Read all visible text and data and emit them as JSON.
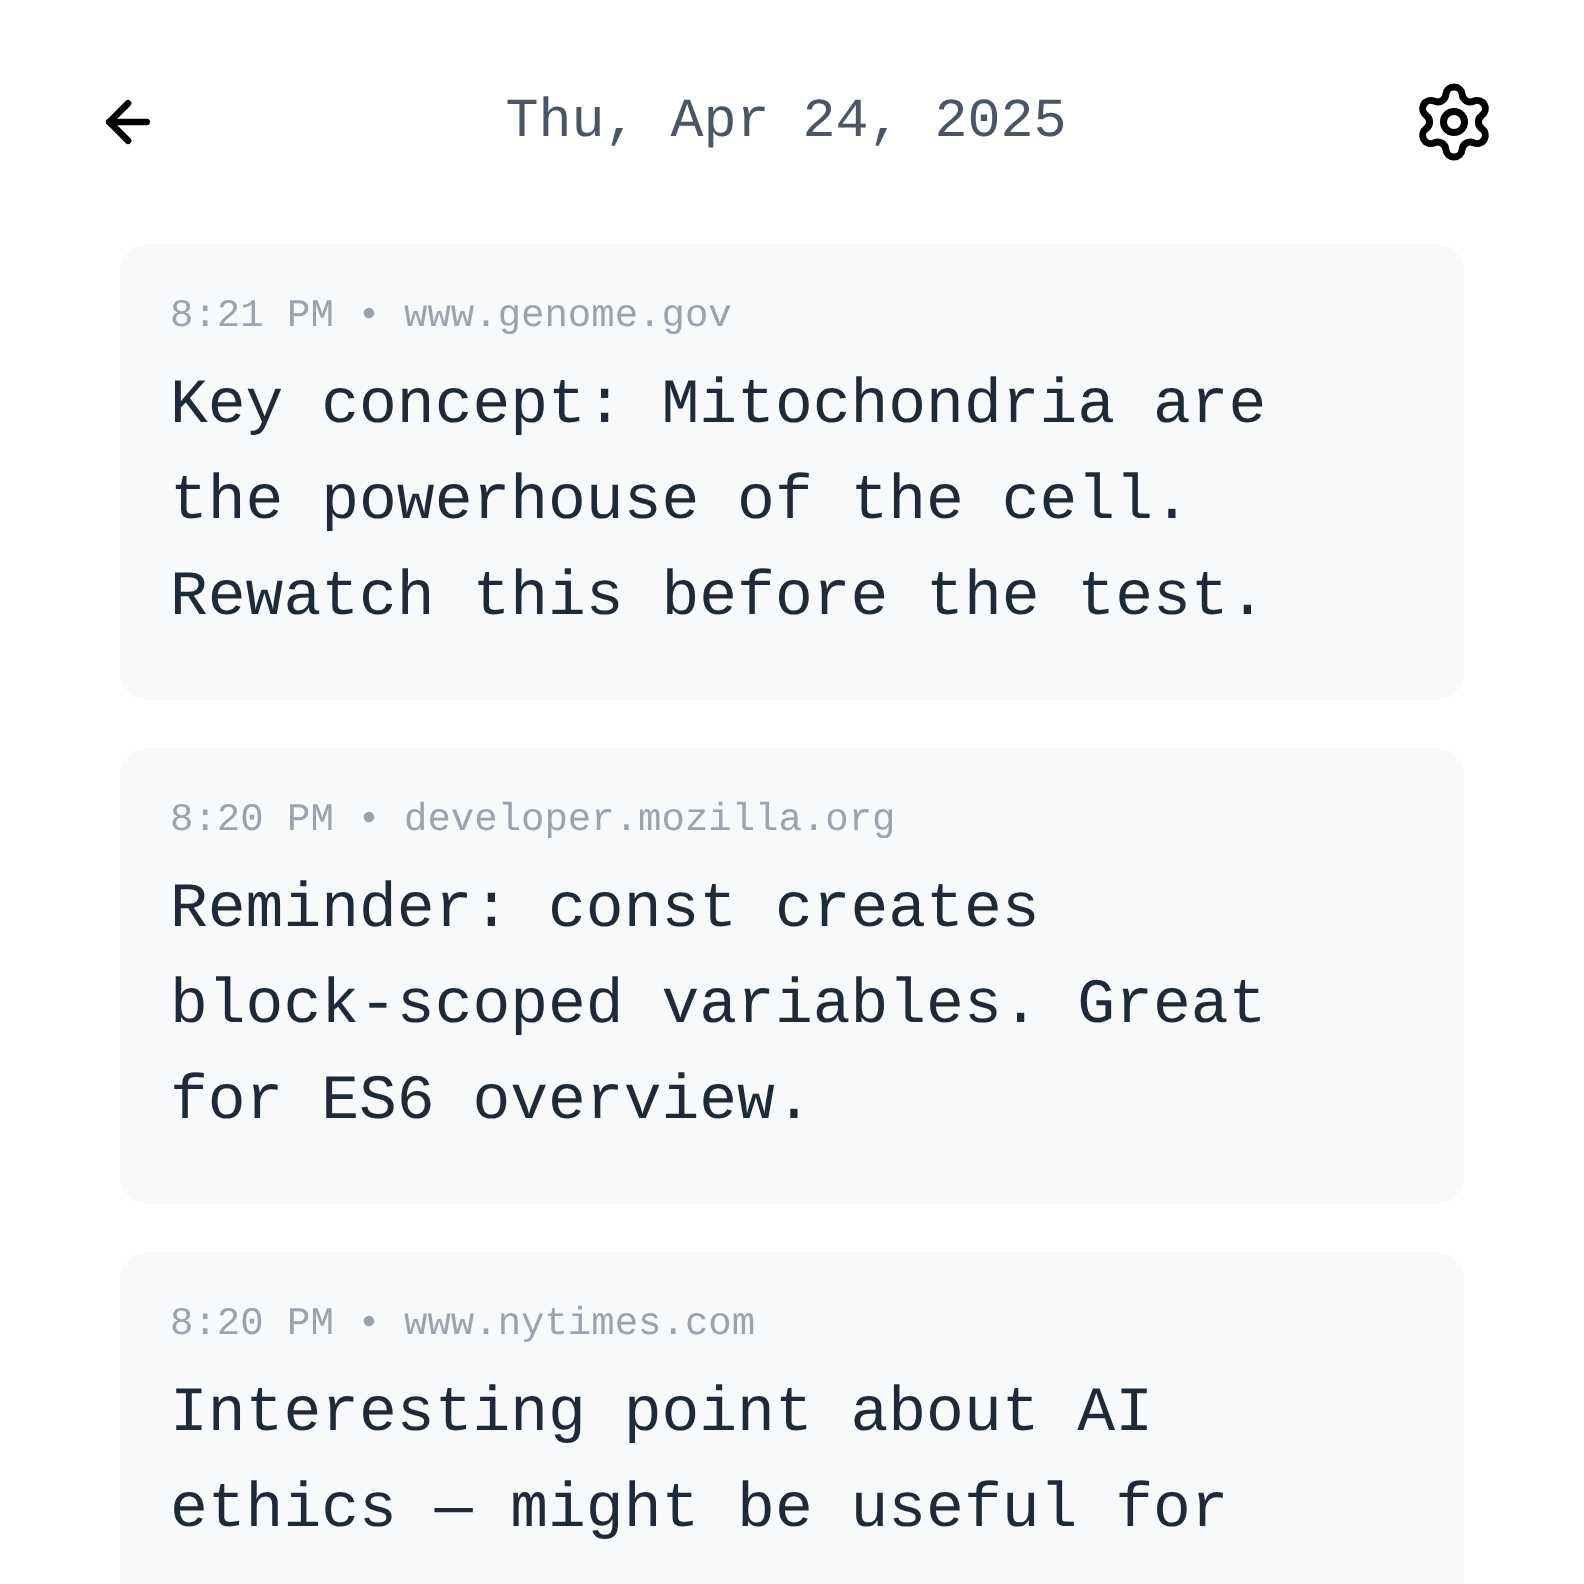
{
  "header": {
    "title": "Thu, Apr 24, 2025"
  },
  "separator": "•",
  "notes": [
    {
      "time": "8:21 PM",
      "source": "www.genome.gov",
      "text": "Key concept: Mitochondria are the powerhouse of the cell. Rewatch this before the test."
    },
    {
      "time": "8:20 PM",
      "source": "developer.mozilla.org",
      "text": "Reminder: const creates block-scoped variables. Great for ES6 overview."
    },
    {
      "time": "8:20 PM",
      "source": "www.nytimes.com",
      "text": "Interesting point about AI ethics — might be useful for"
    }
  ]
}
